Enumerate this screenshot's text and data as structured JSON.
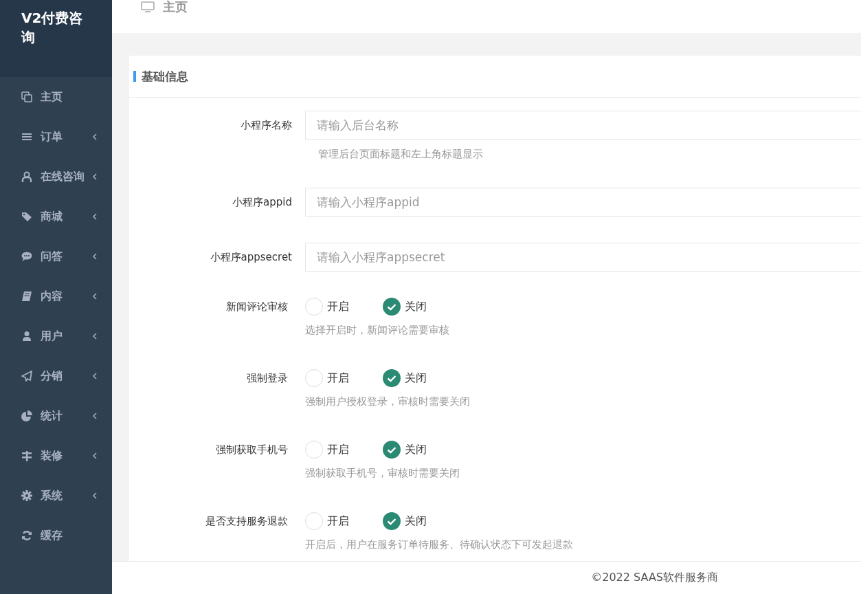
{
  "sidebar": {
    "brand": "V2付费咨询",
    "items": [
      {
        "label": "主页",
        "has_submenu": false
      },
      {
        "label": "订单",
        "has_submenu": true
      },
      {
        "label": "在线咨询",
        "has_submenu": true
      },
      {
        "label": "商城",
        "has_submenu": true
      },
      {
        "label": "问答",
        "has_submenu": true
      },
      {
        "label": "内容",
        "has_submenu": true
      },
      {
        "label": "用户",
        "has_submenu": true
      },
      {
        "label": "分销",
        "has_submenu": true
      },
      {
        "label": "统计",
        "has_submenu": true
      },
      {
        "label": "装修",
        "has_submenu": true
      },
      {
        "label": "系统",
        "has_submenu": true
      },
      {
        "label": "缓存",
        "has_submenu": false
      }
    ]
  },
  "header": {
    "title": "主页"
  },
  "section": {
    "title": "基础信息"
  },
  "fields": [
    {
      "kind": "text",
      "label": "小程序名称",
      "placeholder": "请输入后台名称",
      "help": "管理后台页面标题和左上角标题显示"
    },
    {
      "kind": "text",
      "label": "小程序appid",
      "placeholder": "请输入小程序appid"
    },
    {
      "kind": "text",
      "label": "小程序appsecret",
      "placeholder": "请输入小程序appsecret"
    },
    {
      "kind": "radio",
      "label": "新闻评论审核",
      "options": [
        {
          "label": "开启",
          "selected": false
        },
        {
          "label": "关闭",
          "selected": true
        }
      ],
      "help": "选择开启时，新闻评论需要审核"
    },
    {
      "kind": "radio",
      "label": "强制登录",
      "options": [
        {
          "label": "开启",
          "selected": false
        },
        {
          "label": "关闭",
          "selected": true
        }
      ],
      "help": "强制用户授权登录，审核时需要关闭"
    },
    {
      "kind": "radio",
      "label": "强制获取手机号",
      "options": [
        {
          "label": "开启",
          "selected": false
        },
        {
          "label": "关闭",
          "selected": true
        }
      ],
      "help": "强制获取手机号，审核时需要关闭"
    },
    {
      "kind": "radio",
      "label": "是否支持服务退款",
      "options": [
        {
          "label": "开启",
          "selected": false
        },
        {
          "label": "关闭",
          "selected": true
        }
      ],
      "help": "开启后，用户在服务订单待服务、待确认状态下可发起退款"
    }
  ],
  "footer": "©2022 SAAS软件服务商"
}
